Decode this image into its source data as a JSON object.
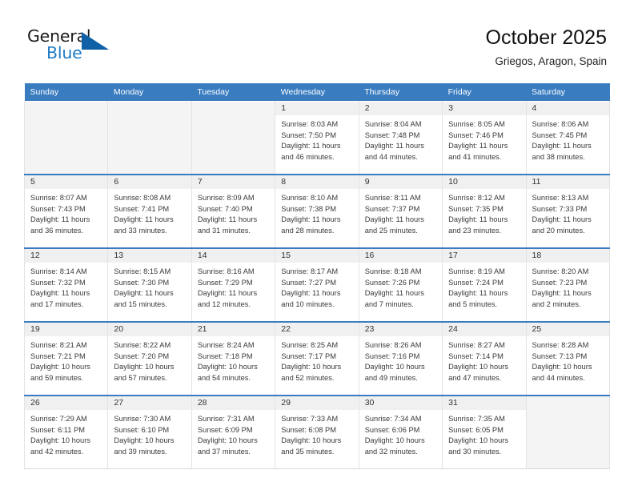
{
  "brand": {
    "name_top": "General",
    "name_bottom": "Blue",
    "accent_color": "#1f7bc4",
    "triangle_color": "#1060a8"
  },
  "header": {
    "title": "October 2025",
    "subtitle": "Griegos, Aragon, Spain"
  },
  "calendar": {
    "header_bg": "#3a7cc0",
    "weekday_headers": [
      "Sunday",
      "Monday",
      "Tuesday",
      "Wednesday",
      "Thursday",
      "Friday",
      "Saturday"
    ],
    "weeks": [
      [
        {
          "day": "",
          "empty": true
        },
        {
          "day": "",
          "empty": true
        },
        {
          "day": "",
          "empty": true
        },
        {
          "day": "1",
          "sunrise": "Sunrise: 8:03 AM",
          "sunset": "Sunset: 7:50 PM",
          "daylight_1": "Daylight: 11 hours",
          "daylight_2": "and 46 minutes."
        },
        {
          "day": "2",
          "sunrise": "Sunrise: 8:04 AM",
          "sunset": "Sunset: 7:48 PM",
          "daylight_1": "Daylight: 11 hours",
          "daylight_2": "and 44 minutes."
        },
        {
          "day": "3",
          "sunrise": "Sunrise: 8:05 AM",
          "sunset": "Sunset: 7:46 PM",
          "daylight_1": "Daylight: 11 hours",
          "daylight_2": "and 41 minutes."
        },
        {
          "day": "4",
          "sunrise": "Sunrise: 8:06 AM",
          "sunset": "Sunset: 7:45 PM",
          "daylight_1": "Daylight: 11 hours",
          "daylight_2": "and 38 minutes."
        }
      ],
      [
        {
          "day": "5",
          "sunrise": "Sunrise: 8:07 AM",
          "sunset": "Sunset: 7:43 PM",
          "daylight_1": "Daylight: 11 hours",
          "daylight_2": "and 36 minutes."
        },
        {
          "day": "6",
          "sunrise": "Sunrise: 8:08 AM",
          "sunset": "Sunset: 7:41 PM",
          "daylight_1": "Daylight: 11 hours",
          "daylight_2": "and 33 minutes."
        },
        {
          "day": "7",
          "sunrise": "Sunrise: 8:09 AM",
          "sunset": "Sunset: 7:40 PM",
          "daylight_1": "Daylight: 11 hours",
          "daylight_2": "and 31 minutes."
        },
        {
          "day": "8",
          "sunrise": "Sunrise: 8:10 AM",
          "sunset": "Sunset: 7:38 PM",
          "daylight_1": "Daylight: 11 hours",
          "daylight_2": "and 28 minutes."
        },
        {
          "day": "9",
          "sunrise": "Sunrise: 8:11 AM",
          "sunset": "Sunset: 7:37 PM",
          "daylight_1": "Daylight: 11 hours",
          "daylight_2": "and 25 minutes."
        },
        {
          "day": "10",
          "sunrise": "Sunrise: 8:12 AM",
          "sunset": "Sunset: 7:35 PM",
          "daylight_1": "Daylight: 11 hours",
          "daylight_2": "and 23 minutes."
        },
        {
          "day": "11",
          "sunrise": "Sunrise: 8:13 AM",
          "sunset": "Sunset: 7:33 PM",
          "daylight_1": "Daylight: 11 hours",
          "daylight_2": "and 20 minutes."
        }
      ],
      [
        {
          "day": "12",
          "sunrise": "Sunrise: 8:14 AM",
          "sunset": "Sunset: 7:32 PM",
          "daylight_1": "Daylight: 11 hours",
          "daylight_2": "and 17 minutes."
        },
        {
          "day": "13",
          "sunrise": "Sunrise: 8:15 AM",
          "sunset": "Sunset: 7:30 PM",
          "daylight_1": "Daylight: 11 hours",
          "daylight_2": "and 15 minutes."
        },
        {
          "day": "14",
          "sunrise": "Sunrise: 8:16 AM",
          "sunset": "Sunset: 7:29 PM",
          "daylight_1": "Daylight: 11 hours",
          "daylight_2": "and 12 minutes."
        },
        {
          "day": "15",
          "sunrise": "Sunrise: 8:17 AM",
          "sunset": "Sunset: 7:27 PM",
          "daylight_1": "Daylight: 11 hours",
          "daylight_2": "and 10 minutes."
        },
        {
          "day": "16",
          "sunrise": "Sunrise: 8:18 AM",
          "sunset": "Sunset: 7:26 PM",
          "daylight_1": "Daylight: 11 hours",
          "daylight_2": "and 7 minutes."
        },
        {
          "day": "17",
          "sunrise": "Sunrise: 8:19 AM",
          "sunset": "Sunset: 7:24 PM",
          "daylight_1": "Daylight: 11 hours",
          "daylight_2": "and 5 minutes."
        },
        {
          "day": "18",
          "sunrise": "Sunrise: 8:20 AM",
          "sunset": "Sunset: 7:23 PM",
          "daylight_1": "Daylight: 11 hours",
          "daylight_2": "and 2 minutes."
        }
      ],
      [
        {
          "day": "19",
          "sunrise": "Sunrise: 8:21 AM",
          "sunset": "Sunset: 7:21 PM",
          "daylight_1": "Daylight: 10 hours",
          "daylight_2": "and 59 minutes."
        },
        {
          "day": "20",
          "sunrise": "Sunrise: 8:22 AM",
          "sunset": "Sunset: 7:20 PM",
          "daylight_1": "Daylight: 10 hours",
          "daylight_2": "and 57 minutes."
        },
        {
          "day": "21",
          "sunrise": "Sunrise: 8:24 AM",
          "sunset": "Sunset: 7:18 PM",
          "daylight_1": "Daylight: 10 hours",
          "daylight_2": "and 54 minutes."
        },
        {
          "day": "22",
          "sunrise": "Sunrise: 8:25 AM",
          "sunset": "Sunset: 7:17 PM",
          "daylight_1": "Daylight: 10 hours",
          "daylight_2": "and 52 minutes."
        },
        {
          "day": "23",
          "sunrise": "Sunrise: 8:26 AM",
          "sunset": "Sunset: 7:16 PM",
          "daylight_1": "Daylight: 10 hours",
          "daylight_2": "and 49 minutes."
        },
        {
          "day": "24",
          "sunrise": "Sunrise: 8:27 AM",
          "sunset": "Sunset: 7:14 PM",
          "daylight_1": "Daylight: 10 hours",
          "daylight_2": "and 47 minutes."
        },
        {
          "day": "25",
          "sunrise": "Sunrise: 8:28 AM",
          "sunset": "Sunset: 7:13 PM",
          "daylight_1": "Daylight: 10 hours",
          "daylight_2": "and 44 minutes."
        }
      ],
      [
        {
          "day": "26",
          "sunrise": "Sunrise: 7:29 AM",
          "sunset": "Sunset: 6:11 PM",
          "daylight_1": "Daylight: 10 hours",
          "daylight_2": "and 42 minutes."
        },
        {
          "day": "27",
          "sunrise": "Sunrise: 7:30 AM",
          "sunset": "Sunset: 6:10 PM",
          "daylight_1": "Daylight: 10 hours",
          "daylight_2": "and 39 minutes."
        },
        {
          "day": "28",
          "sunrise": "Sunrise: 7:31 AM",
          "sunset": "Sunset: 6:09 PM",
          "daylight_1": "Daylight: 10 hours",
          "daylight_2": "and 37 minutes."
        },
        {
          "day": "29",
          "sunrise": "Sunrise: 7:33 AM",
          "sunset": "Sunset: 6:08 PM",
          "daylight_1": "Daylight: 10 hours",
          "daylight_2": "and 35 minutes."
        },
        {
          "day": "30",
          "sunrise": "Sunrise: 7:34 AM",
          "sunset": "Sunset: 6:06 PM",
          "daylight_1": "Daylight: 10 hours",
          "daylight_2": "and 32 minutes."
        },
        {
          "day": "31",
          "sunrise": "Sunrise: 7:35 AM",
          "sunset": "Sunset: 6:05 PM",
          "daylight_1": "Daylight: 10 hours",
          "daylight_2": "and 30 minutes."
        },
        {
          "day": "",
          "empty": true
        }
      ]
    ]
  }
}
